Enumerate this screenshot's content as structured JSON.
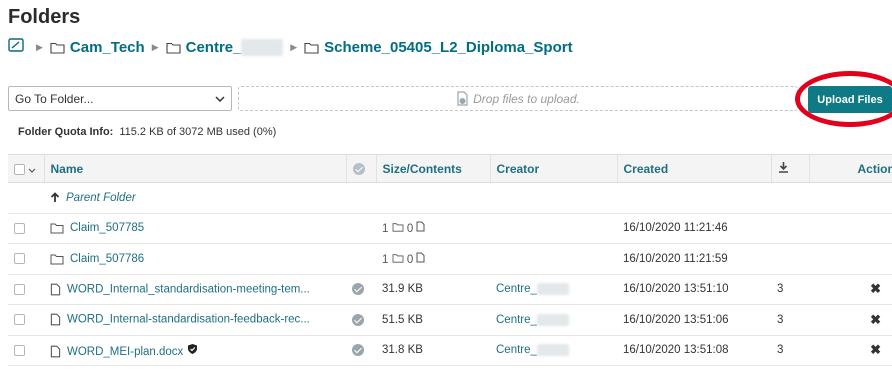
{
  "page": {
    "title": "Folders"
  },
  "breadcrumb": {
    "items": [
      {
        "prefix": "Cam_Tech",
        "redacted": ""
      },
      {
        "prefix": "Centre_",
        "redacted": "00000"
      },
      {
        "prefix": "Scheme_05405_L2_Diploma_Sport",
        "redacted": ""
      }
    ],
    "separator": "▶"
  },
  "toolbar": {
    "goto_label": "Go To Folder...",
    "drop_text": "Drop files to upload.",
    "upload_label": "Upload Files"
  },
  "quota": {
    "label": "Folder Quota Info:",
    "value": "115.2 KB of 3072 MB used (0%)"
  },
  "table": {
    "headers": {
      "name": "Name",
      "size": "Size/Contents",
      "creator": "Creator",
      "created": "Created",
      "actions": "Actions"
    },
    "parent_label": "Parent Folder",
    "folders": [
      {
        "name": "Claim_507785",
        "folders": "1",
        "files": "0",
        "created": "16/10/2020 11:21:46"
      },
      {
        "name": "Claim_507786",
        "folders": "1",
        "files": "0",
        "created": "16/10/2020 11:21:59"
      }
    ],
    "files": [
      {
        "name": "WORD_Internal_standardisation-meeting-tem...",
        "size": "31.9 KB",
        "creator": "Centre_",
        "creator_redacted": "00000",
        "created": "16/10/2020 13:51:10",
        "downloads": "3"
      },
      {
        "name": "WORD_Internal-standardisation-feedback-rec...",
        "size": "51.5 KB",
        "creator": "Centre_",
        "creator_redacted": "00000",
        "created": "16/10/2020 13:51:06",
        "downloads": "3"
      },
      {
        "name": "WORD_MEI-plan.docx",
        "size": "31.8 KB",
        "creator": "Centre_",
        "creator_redacted": "00000",
        "created": "16/10/2020 13:51:08",
        "downloads": "3"
      }
    ]
  },
  "colors": {
    "accent": "#0d7a86",
    "link": "#1f6f82",
    "highlight_ring": "#e3001b"
  },
  "icons": {
    "home": "folder-home-icon",
    "folder": "folder-icon",
    "file": "file-icon",
    "check": "check-circle-icon",
    "shield": "shield-icon",
    "delete": "delete-icon",
    "download": "download-icon",
    "parent": "up-arrow-icon"
  }
}
